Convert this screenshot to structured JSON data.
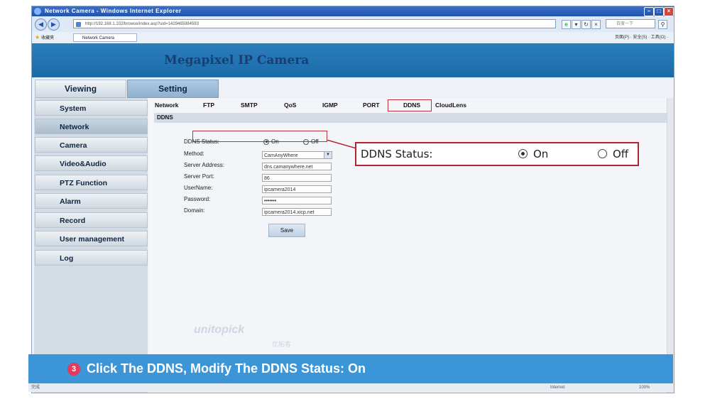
{
  "browser": {
    "title": "Network Camera - Windows Internet Explorer",
    "url": "http://192.168.1.102/browse/index.asp?uid=1429485984593",
    "search_placeholder": "百度一下",
    "favorites_label": "收藏夹",
    "tab_label": "Network Camera",
    "command_bar": "页面(P) · 安全(S) · 工具(O) ·",
    "status_left": "完成",
    "status_right": "Internet",
    "zoom": "100%"
  },
  "camera": {
    "title": "Megapixel IP Camera",
    "top_tabs": {
      "viewing": "Viewing",
      "setting": "Setting"
    },
    "sidebar": [
      "System",
      "Network",
      "Camera",
      "Video&Audio",
      "PTZ Function",
      "Alarm",
      "Record",
      "User management",
      "Log"
    ],
    "active_sidebar": "Network",
    "subtabs": [
      "Network",
      "FTP",
      "SMTP",
      "QoS",
      "IGMP",
      "PORT",
      "DDNS",
      "CloudLens"
    ],
    "active_subtab": "DDNS",
    "section_title": "DDNS",
    "form": {
      "status_label": "DDNS Status:",
      "on_label": "On",
      "off_label": "Off",
      "status_value": "On",
      "method_label": "Method:",
      "method_value": "CamAnyWhere",
      "server_address_label": "Server Address:",
      "server_address_value": "dns.camanywhere.net",
      "server_port_label": "Server Port:",
      "server_port_value": "86",
      "username_label": "UserName:",
      "username_value": "ipcamera2014",
      "password_label": "Password:",
      "password_value": "•••••••",
      "domain_label": "Domain:",
      "domain_value": "ipcamera2014.xicp.net",
      "save_label": "Save"
    }
  },
  "watermark": {
    "text": "unitopick",
    "sub": "优拓客"
  },
  "callout": {
    "label": "DDNS Status:",
    "on": "On",
    "off": "Off"
  },
  "banner": {
    "step": "3",
    "text": "Click The DDNS, Modify The DDNS Status: On"
  },
  "colors": {
    "highlight": "#c0303c",
    "banner": "#3b95d6",
    "step_badge": "#e63a5c",
    "camera_header": "#2b7fbc"
  }
}
